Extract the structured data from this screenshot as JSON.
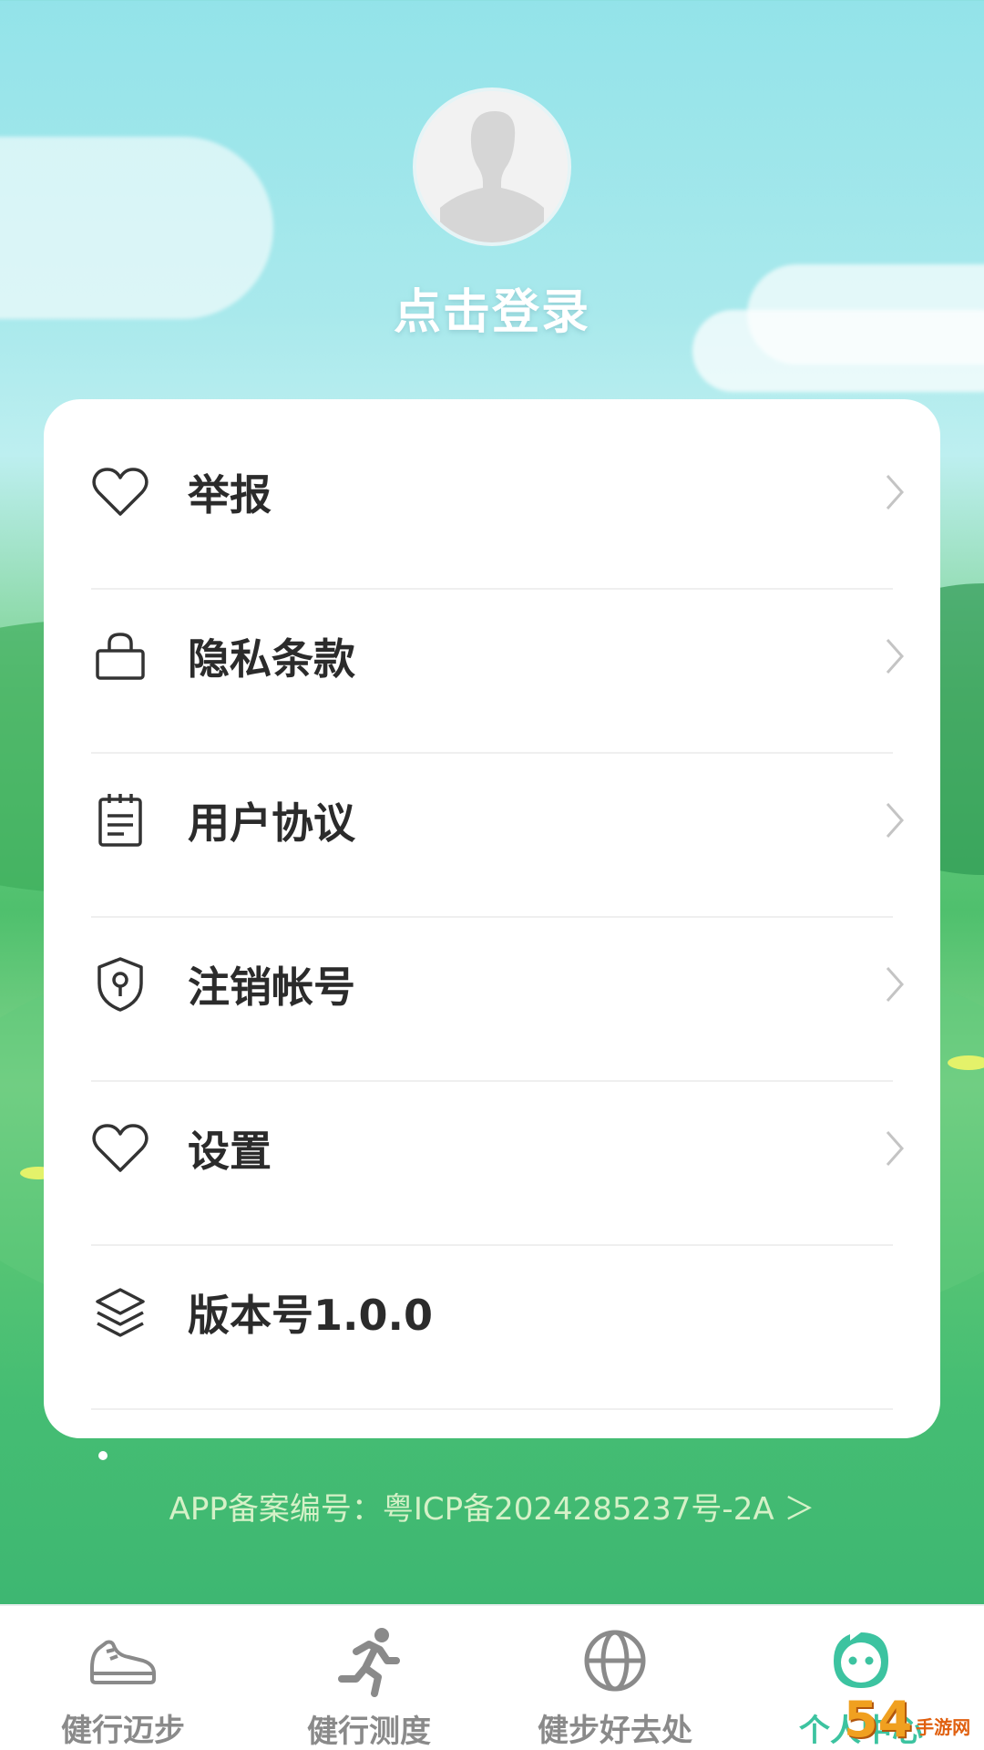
{
  "profile": {
    "login_label": "点击登录"
  },
  "menu": {
    "items": [
      {
        "label": "举报",
        "icon": "heart-icon",
        "has_chevron": true
      },
      {
        "label": "隐私条款",
        "icon": "lock-icon",
        "has_chevron": true
      },
      {
        "label": "用户协议",
        "icon": "document-icon",
        "has_chevron": true
      },
      {
        "label": "注销帐号",
        "icon": "shield-key-icon",
        "has_chevron": true
      },
      {
        "label": "设置",
        "icon": "heart-icon",
        "has_chevron": true
      },
      {
        "label": "版本号1.0.0",
        "icon": "layers-icon",
        "has_chevron": false
      }
    ]
  },
  "footer": {
    "icp_text": "APP备案编号：粤ICP备2024285237号-2A ＞"
  },
  "tabbar": {
    "tabs": [
      {
        "label": "健行迈步",
        "icon": "sneaker-icon",
        "active": false
      },
      {
        "label": "健行测度",
        "icon": "running-person-icon",
        "active": false
      },
      {
        "label": "健步好去处",
        "icon": "globe-icon",
        "active": false
      },
      {
        "label": "个人中心",
        "icon": "smiley-face-icon",
        "active": true
      }
    ]
  },
  "colors": {
    "accent": "#3cc3a0",
    "inactive_tab": "#8a8a8a",
    "menu_text": "#2b2b2b",
    "icp_text": "#d5f1c7"
  },
  "watermark": {
    "number": "54",
    "text": "手游网"
  }
}
